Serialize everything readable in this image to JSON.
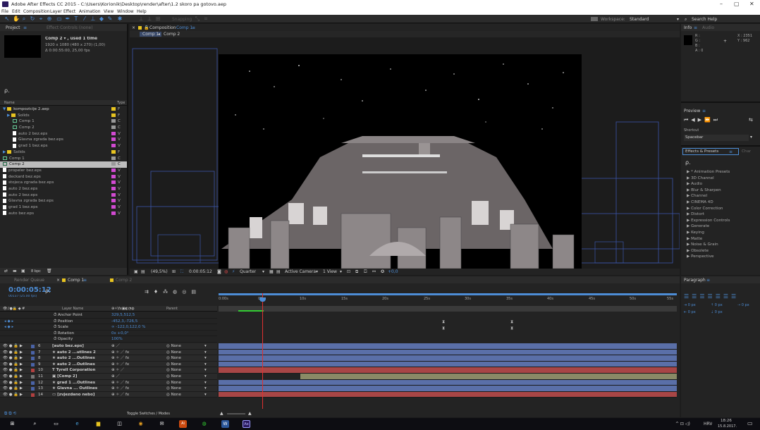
{
  "window": {
    "title": "Adobe After Effects CC 2015 - C:\\Users\\Korionik\\Desktop\\render\\after\\1.2 skoro pa gotovo.aep",
    "min": "–",
    "max": "▢",
    "close": "✕"
  },
  "menu": [
    "File",
    "Edit",
    "Composition",
    "Layer",
    "Effect",
    "Animation",
    "View",
    "Window",
    "Help"
  ],
  "toolbar": {
    "snapping": "Snapping",
    "workspace_label": "Workspace:",
    "workspace_value": "Standard",
    "search_placeholder": "Search Help"
  },
  "project": {
    "tab": "Project",
    "tab2": "Effect Controls (none)",
    "item_name": "Comp 2 ▾ , used 1 time",
    "item_dims": "1920 x 1080 (480 x 270) (1,00)",
    "item_dur": "Δ 0:00:55:00, 25,00 fps",
    "search": "ρ.",
    "col_name": "Name",
    "col_type": "Type",
    "bpc": "8 bpc",
    "items": [
      {
        "name": "kompozicije 2.aep",
        "icon": "folder",
        "type": "F",
        "indent": 0
      },
      {
        "name": "Solids",
        "icon": "folder",
        "type": "F",
        "indent": 1
      },
      {
        "name": "Comp 1",
        "icon": "comp",
        "type": "C",
        "indent": 2
      },
      {
        "name": "Comp 2",
        "icon": "comp",
        "type": "C",
        "indent": 2
      },
      {
        "name": "auto 2 bez.eps",
        "icon": "file",
        "type": "V",
        "indent": 2
      },
      {
        "name": "Glavna zgrada bez.eps",
        "icon": "file",
        "type": "V",
        "indent": 2
      },
      {
        "name": "grad 1 bez.eps",
        "icon": "file",
        "type": "V",
        "indent": 2
      },
      {
        "name": "Solids",
        "icon": "folder",
        "type": "F",
        "indent": 0
      },
      {
        "name": "Comp 1",
        "icon": "comp",
        "type": "C",
        "indent": 0
      },
      {
        "name": "Comp 2",
        "icon": "comp",
        "type": "C",
        "indent": 0,
        "selected": true
      },
      {
        "name": "propeler bez.eps",
        "icon": "file",
        "type": "V",
        "indent": 0
      },
      {
        "name": "deckard bez.eps",
        "icon": "file",
        "type": "V",
        "indent": 0
      },
      {
        "name": "stojeca zgrada bez.eps",
        "icon": "file",
        "type": "V",
        "indent": 0
      },
      {
        "name": "auto 2 bez.eps",
        "icon": "file",
        "type": "V",
        "indent": 0
      },
      {
        "name": "auto 2 bez.eps",
        "icon": "file",
        "type": "V",
        "indent": 0
      },
      {
        "name": "Glavna zgrada bez.eps",
        "icon": "file",
        "type": "V",
        "indent": 0
      },
      {
        "name": "grad 1 bez.eps",
        "icon": "file",
        "type": "V",
        "indent": 0
      },
      {
        "name": "auto bez.eps",
        "icon": "file",
        "type": "V",
        "indent": 0
      }
    ]
  },
  "comp": {
    "tab": "Composition",
    "tab_comp": "Comp 1",
    "crumb1": "Comp 1",
    "crumb_arrow": "◂",
    "crumb2": "Comp 2",
    "zoom": "(49,5%)",
    "time": "0:00:05:12",
    "quality": "Quarter",
    "camera": "Active Camera",
    "view": "1 View",
    "exposure": "+0,0"
  },
  "info": {
    "tab": "Info",
    "tab2": "Audio",
    "r": "R :",
    "g": "G :",
    "b": "B :",
    "a": "A : 0",
    "x": "X : 2351",
    "y": "Y : 962",
    "cross": "+"
  },
  "preview": {
    "tab": "Preview",
    "shortcut_label": "Shortcut",
    "shortcut": "Spacebar"
  },
  "effects": {
    "tab": "Effects & Presets",
    "tab2": "Char",
    "search": "ρ.",
    "items": [
      "* Animation Presets",
      "3D Channel",
      "Audio",
      "Blur & Sharpen",
      "Channel",
      "CINEMA 4D",
      "Color Correction",
      "Distort",
      "Expression Controls",
      "Generate",
      "Keying",
      "Matte",
      "Noise & Grain",
      "Obsolete",
      "Perspective"
    ]
  },
  "paragraph": {
    "tab": "Paragraph",
    "a1": "0 px",
    "a2": "0 px",
    "a3": "0 px",
    "a4": "0 px",
    "a5": "0 px"
  },
  "timeline": {
    "tab_rq": "Render Queue",
    "tab1": "Comp 1",
    "tab2": "Comp 2",
    "timecode": "0:00:05:12",
    "frames": "00137 (25.00 fps)",
    "search": "ρ.",
    "col_layer": "Layer Name",
    "col_parent": "Parent",
    "toggle": "Toggle Switches / Modes",
    "ruler": [
      "0:00s",
      "05s",
      "10s",
      "15s",
      "20s",
      "25s",
      "30s",
      "35s",
      "40s",
      "45s",
      "50s",
      "55s"
    ],
    "props": [
      {
        "name": "Anchor Point",
        "value": "329,5,512,5"
      },
      {
        "name": "Position",
        "value": "-452,3,-726,5"
      },
      {
        "name": "Scale",
        "value": "∞ -122,0,122,0 %"
      },
      {
        "name": "Rotation",
        "value": "0x +0,0°"
      },
      {
        "name": "Opacity",
        "value": "100%"
      }
    ],
    "layers": [
      {
        "num": "6",
        "name": "[auto bez.eps]",
        "parent": "None",
        "color": "#4a63a6",
        "bar": "#5a6fa8",
        "bold": false
      },
      {
        "num": "7",
        "name": "auto 2 ...utlines 2",
        "parent": "None",
        "color": "#4a63a6",
        "bar": "#5a6fa8",
        "bold": false
      },
      {
        "num": "8",
        "name": "auto 2 ...Outlines",
        "parent": "None",
        "color": "#4a63a6",
        "bar": "#5a6fa8",
        "bold": false
      },
      {
        "num": "9",
        "name": "auto 2 ...Outlines",
        "parent": "None",
        "color": "#4a63a6",
        "bar": "#5a6fa8",
        "bold": false
      },
      {
        "num": "10",
        "name": "Tyrell Corporation",
        "parent": "None",
        "color": "#b04040",
        "bar": "#a84646",
        "bold": true
      },
      {
        "num": "11",
        "name": "[Comp 2]",
        "parent": "None",
        "color": "#777",
        "bar": "#8a8a66",
        "bold": false
      },
      {
        "num": "12",
        "name": "grad 1 ...Outlines",
        "parent": "None",
        "color": "#4a63a6",
        "bar": "#5a6fa8",
        "bold": false
      },
      {
        "num": "13",
        "name": "Glavna ... Outlines",
        "parent": "None",
        "color": "#4a63a6",
        "bar": "#5a6fa8",
        "bold": false
      },
      {
        "num": "14",
        "name": "[zvjezdano nebo]",
        "parent": "None",
        "color": "#b04040",
        "bar": "#a84646",
        "bold": false
      }
    ]
  },
  "tray": {
    "lang": "HRV",
    "time": "18:26",
    "date": "15.8.2017."
  }
}
